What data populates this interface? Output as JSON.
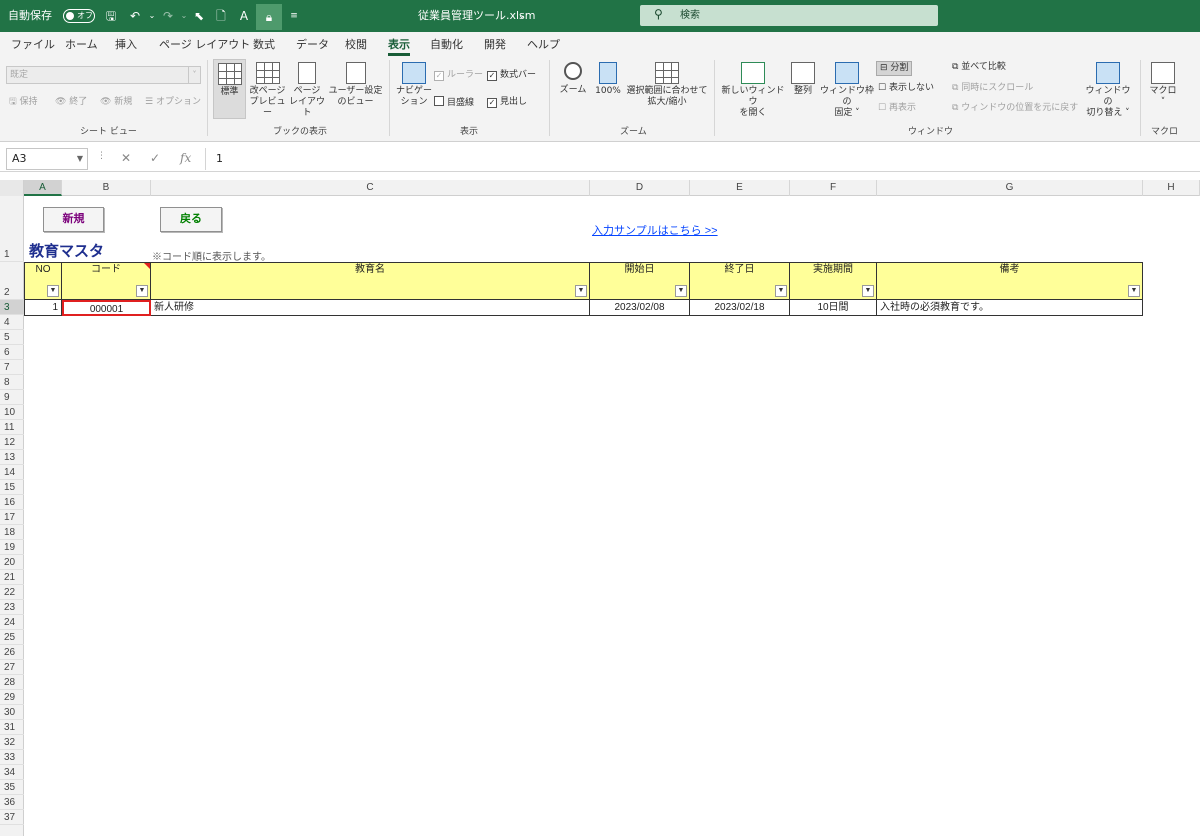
{
  "titlebar": {
    "autosave_label": "自動保存",
    "autosave_state": "オフ",
    "file_name": "従業員管理ツール.xlsm",
    "search_placeholder": "検索",
    "accent_color": "#217346"
  },
  "menu": {
    "tabs": [
      "ファイル",
      "ホーム",
      "挿入",
      "ページ レイアウト",
      "数式",
      "データ",
      "校閲",
      "表示",
      "自動化",
      "開発",
      "ヘルプ"
    ],
    "active_tab": "表示"
  },
  "ribbon": {
    "sheet_view": {
      "select_value": "既定",
      "keep": "保持",
      "exit": "終了",
      "new": "新規",
      "options": "オプション",
      "group_label": "シート ビュー"
    },
    "book_view": {
      "normal": "標準",
      "page_break_1": "改ページ",
      "page_break_2": "プレビュー",
      "page_layout_1": "ページ",
      "page_layout_2": "レイアウト",
      "custom_1": "ユーザー設定",
      "custom_2": "のビュー",
      "group_label": "ブックの表示"
    },
    "show": {
      "nav_1": "ナビゲー",
      "nav_2": "ション",
      "ruler": "ルーラー",
      "formula_bar": "数式バー",
      "gridlines": "目盛線",
      "headings": "見出し",
      "group_label": "表示"
    },
    "zoom": {
      "zoom": "ズーム",
      "hundred": "100%",
      "fit_1": "選択範囲に合わせて",
      "fit_2": "拡大/縮小",
      "group_label": "ズーム"
    },
    "window": {
      "new_window_1": "新しいウィンドウ",
      "new_window_2": "を開く",
      "arrange": "整列",
      "freeze_1": "ウィンドウ枠の",
      "freeze_2": "固定 ˅",
      "split": "分割",
      "hide": "表示しない",
      "unhide": "再表示",
      "side_by_side": "並べて比較",
      "sync_scroll": "同時にスクロール",
      "reset_position": "ウィンドウの位置を元に戻す",
      "switch_1": "ウィンドウの",
      "switch_2": "切り替え ˅",
      "group_label": "ウィンドウ"
    },
    "macro": {
      "label": "マクロ",
      "group_label": "マクロ"
    }
  },
  "formula_bar": {
    "name_box": "A3",
    "formula": "1"
  },
  "sheet": {
    "columns": [
      "A",
      "B",
      "C",
      "D",
      "E",
      "F",
      "G",
      "H"
    ],
    "selected_column": "A",
    "rows": [
      "1",
      "2",
      "3",
      "4",
      "5",
      "6",
      "7",
      "8",
      "9",
      "10",
      "11",
      "12",
      "13",
      "14",
      "15",
      "16",
      "17",
      "18",
      "19",
      "20",
      "21",
      "22",
      "23",
      "24",
      "25",
      "26",
      "27",
      "28",
      "29",
      "30",
      "31",
      "32",
      "33",
      "34",
      "35",
      "36",
      "37"
    ],
    "selected_row": "3",
    "btn_new": "新規",
    "btn_back": "戻る",
    "btn_new_color": "#7b007b",
    "btn_back_color": "#008000",
    "sample_link": "入力サンプルはこちら >>",
    "title": "教育マスタ",
    "note": "※コード順に表示します。",
    "headers": [
      "NO",
      "コード",
      "教育名",
      "開始日",
      "終了日",
      "実施期間",
      "備考"
    ],
    "header_color": "#ffff99",
    "record": {
      "no": "1",
      "code": "000001",
      "name": "新人研修",
      "start": "2023/02/08",
      "end": "2023/02/18",
      "period": "10日間",
      "remarks": "入社時の必須教育です。"
    }
  }
}
